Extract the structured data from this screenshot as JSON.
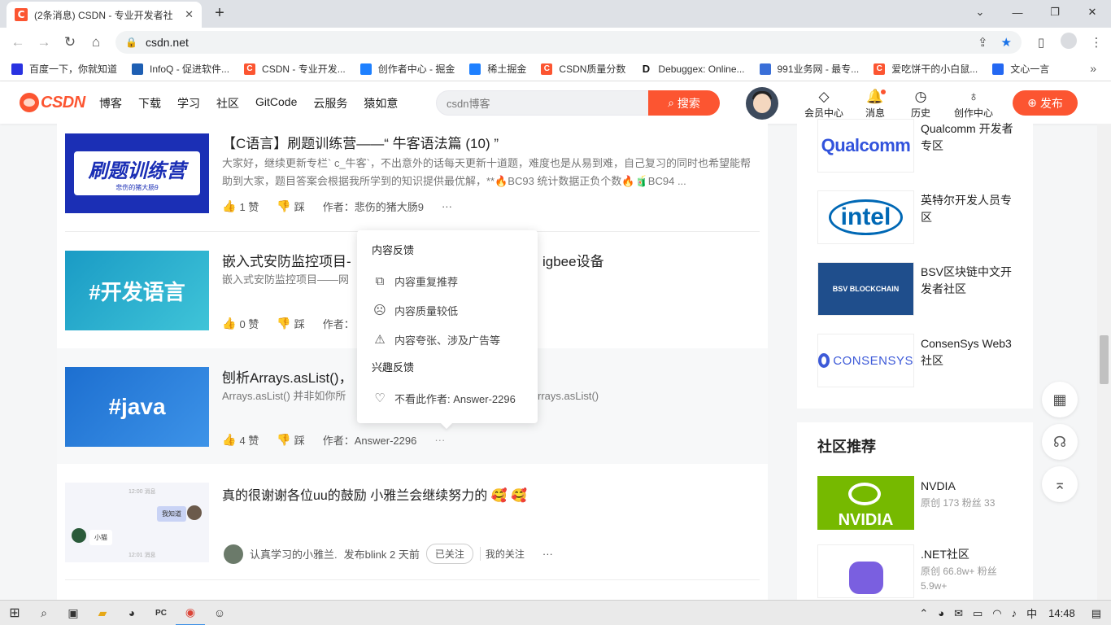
{
  "browser": {
    "tab_title": "(2条消息) CSDN - 专业开发者社",
    "tab_close": "✕",
    "new_tab": "+",
    "url": "csdn.net",
    "win_min": "—",
    "win_max": "❐",
    "win_close": "✕",
    "bookmarks_more": "»"
  },
  "bookmarks": [
    {
      "label": "百度一下，你就知道",
      "icon": "paw-icon",
      "color": "#2932e1"
    },
    {
      "label": "InfoQ - 促进软件...",
      "icon": "infoq-icon",
      "color": "#1e5fb3"
    },
    {
      "label": "CSDN - 专业开发...",
      "icon": "csdn-icon",
      "color": "#fc5531"
    },
    {
      "label": "创作者中心 - 掘金",
      "icon": "juejin-icon",
      "color": "#1e80ff"
    },
    {
      "label": "稀土掘金",
      "icon": "juejin-icon",
      "color": "#1e80ff"
    },
    {
      "label": "CSDN质量分数",
      "icon": "csdn-icon",
      "color": "#fc5531"
    },
    {
      "label": "Debuggex: Online...",
      "icon": "d-icon",
      "color": "#111111"
    },
    {
      "label": "991业务网 - 最专...",
      "icon": "globe-icon",
      "color": "#3a6fd8"
    },
    {
      "label": "爱吃饼干的小白鼠...",
      "icon": "csdn-icon",
      "color": "#fc5531"
    },
    {
      "label": "文心一言",
      "icon": "wenxin-icon",
      "color": "#2468f2"
    }
  ],
  "header": {
    "logo": "CSDN",
    "nav": [
      "博客",
      "下载",
      "学习",
      "社区",
      "GitCode",
      "云服务",
      "猿如意"
    ],
    "search_placeholder": "csdn博客",
    "search_button": "搜索",
    "tools": [
      {
        "label": "会员中心",
        "icon": "diamond-icon"
      },
      {
        "label": "消息",
        "icon": "bell-icon"
      },
      {
        "label": "历史",
        "icon": "clock-icon"
      },
      {
        "label": "创作中心",
        "icon": "bulb-icon"
      }
    ],
    "publish": "发布"
  },
  "articles": [
    {
      "title": "【C语言】刷题训练营——“ 牛客语法篇 (10) ”",
      "desc": "大家好，继续更新专栏` c_牛客`，不出意外的话每天更新十道题，难度也是从易到难，自己复习的同时也希望能帮助到大家，题目答案会根据我所学到的知识提供最优解，**🔥BC93 统计数据正负个数🔥🧃BC94 ...",
      "likes": "1 赞",
      "dislike": "踩",
      "author": "作者：悲伤的猪大肠9",
      "more": "···",
      "thumb_text": "刷题训练营",
      "thumb_sub": "悲伤的猪大肠9"
    },
    {
      "title_left": "嵌入式安防监控项目-",
      "title_right": "igbee设备",
      "desc": "嵌入式安防监控项目——网",
      "likes": "0 赞",
      "dislike": "踩",
      "author": "作者：",
      "thumb_text": "#开发语言"
    },
    {
      "title": "刨析Arrays.asList()，",
      "desc_left": "Arrays.asList() 并非如你所",
      "desc_right": "rrays.asList()",
      "likes": "4 赞",
      "dislike": "踩",
      "author": "作者：Answer-2296",
      "more": "···",
      "thumb_text": "#java"
    },
    {
      "title": "真的很谢谢各位uu的鼓励 小雅兰会继续努力的 🥰 🥰",
      "author": "认真学习的小雅兰.",
      "published": "发布blink 2 天前",
      "follow": "已关注",
      "my_follow": "我的关注",
      "more": "···",
      "thumb_bubble": "我知道",
      "thumb_bubble2": "小猫",
      "thumb_top": "12:00 消息",
      "thumb_bottom": "12:01 消息"
    }
  ],
  "popup": {
    "content_head": "内容反馈",
    "items": [
      {
        "label": "内容重复推荐",
        "icon": "copy-icon"
      },
      {
        "label": "内容质量较低",
        "icon": "sad-face-icon"
      },
      {
        "label": "内容夸张、涉及广告等",
        "icon": "warning-icon"
      }
    ],
    "interest_head": "兴趣反馈",
    "interest_item": "不看此作者: Answer-2296"
  },
  "sidebar": {
    "zones": [
      {
        "name": "Qualcomm 开发者专区",
        "logo": "Qualcomm"
      },
      {
        "name": "英特尔开发人员专区",
        "logo": "intel"
      },
      {
        "name": "BSV区块链中文开发者社区",
        "logo": "BSV BLOCKCHAIN"
      },
      {
        "name": "ConsenSys Web3社区",
        "logo": "CONSENSYS"
      }
    ],
    "community_title": "社区推荐",
    "communities": [
      {
        "name": "NVDIA",
        "stats": "原创 173   粉丝 33",
        "logo": "NVIDIA"
      },
      {
        "name": ".NET社区",
        "stats": "原创 66.8w+   粉丝 5.9w+",
        "logo": ""
      }
    ]
  },
  "taskbar": {
    "time": "14:48",
    "ime": "中"
  }
}
